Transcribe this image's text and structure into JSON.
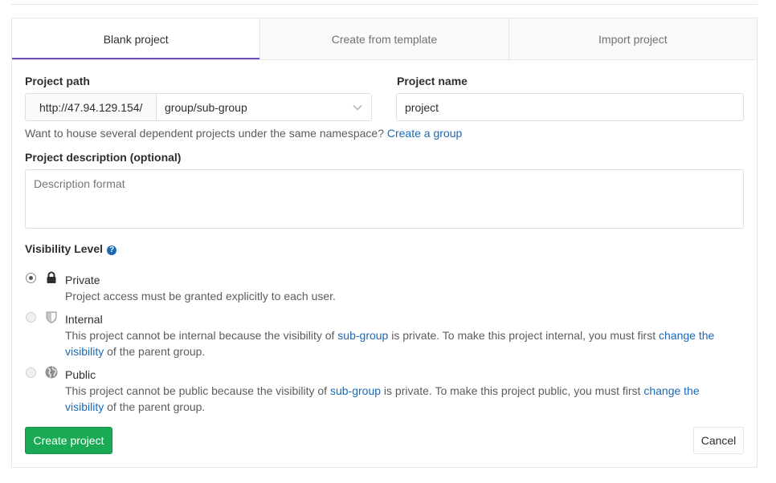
{
  "tabs": [
    {
      "label": "Blank project",
      "active": true
    },
    {
      "label": "Create from template",
      "active": false
    },
    {
      "label": "Import project",
      "active": false
    }
  ],
  "form": {
    "project_path_label": "Project path",
    "path_prefix": "http://47.94.129.154/",
    "namespace_selected": "group/sub-group",
    "project_name_label": "Project name",
    "project_name_value": "project",
    "namespace_help": "Want to house several dependent projects under the same namespace?",
    "create_group_link": "Create a group",
    "description_label": "Project description (optional)",
    "description_placeholder": "Description format",
    "visibility_label": "Visibility Level",
    "visibility_help_icon": "?"
  },
  "visibility": {
    "private": {
      "title": "Private",
      "icon": "lock-icon",
      "checked": true,
      "desc": "Project access must be granted explicitly to each user."
    },
    "internal": {
      "title": "Internal",
      "icon": "shield-icon",
      "checked": false,
      "desc_a": "This project cannot be internal because the visibility of",
      "group_link": "sub-group",
      "desc_b": "is private. To make this project internal, you must first",
      "change_link": "change the visibility",
      "desc_c": "of the parent group."
    },
    "public": {
      "title": "Public",
      "icon": "globe-icon",
      "checked": false,
      "desc_a": "This project cannot be public because the visibility of",
      "group_link": "sub-group",
      "desc_b": "is private. To make this project public, you must first",
      "change_link": "change the visibility",
      "desc_c": "of the parent group."
    }
  },
  "actions": {
    "create_label": "Create project",
    "cancel_label": "Cancel"
  },
  "colors": {
    "accent_tab": "#6b4fbb",
    "link": "#1b69b6",
    "primary_button": "#1aaa55"
  }
}
